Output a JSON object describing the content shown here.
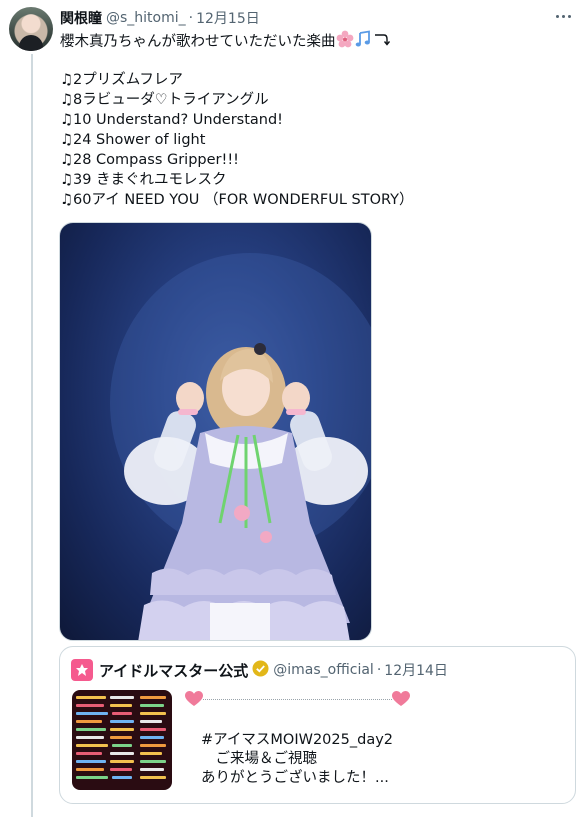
{
  "post": {
    "display_name": "関根瞳",
    "handle": "@s_hitomi_",
    "separator": "·",
    "date": "12月15日",
    "text_lines": [
      "櫻木真乃ちゃんが歌わせていただいた楽曲",
      "",
      "♫2プリズムフレア",
      "♫8ラビューダ♡トライアングル",
      "♫10 Understand? Understand!",
      "♫24 Shower of light",
      "♫28 Compass Gripper!!!",
      "♫39 きまぐれユモレスク",
      "♫60アイ NEED YOU （FOR WONDERFUL STORY）"
    ],
    "first_line_emojis": [
      "cherry-blossom-icon",
      "music-notes-icon",
      "arrow-curve-icon"
    ]
  },
  "quote": {
    "display_name": "アイドルマスター公式",
    "handle": "@imas_official",
    "separator": "·",
    "date": "12月14日",
    "lines": [
      "#アイマスMOIW2025_day2",
      "　ご来場＆ご視聴",
      "ありがとうございました！..."
    ]
  },
  "colors": {
    "text": "#0f1419",
    "secondary": "#536471",
    "border": "#cfd9de",
    "heart": "#f07a9a",
    "logo": "#f55a8e",
    "verified": "#e2b719"
  }
}
